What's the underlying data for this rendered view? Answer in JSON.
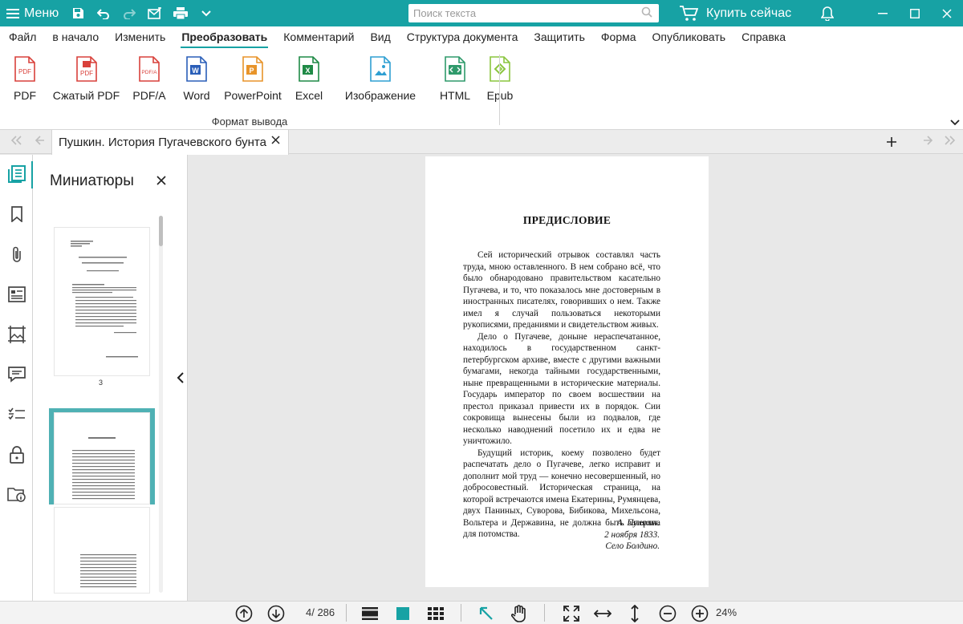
{
  "titlebar": {
    "menu_label": "Меню",
    "search_placeholder": "Поиск текста",
    "buy_label": "Купить сейчас"
  },
  "menubar": {
    "items": [
      "Файл",
      "в начало",
      "Изменить",
      "Преобразовать",
      "Комментарий",
      "Вид",
      "Структура документа",
      "Защитить",
      "Форма",
      "Опубликовать",
      "Справка"
    ],
    "active": "Преобразовать"
  },
  "ribbon": {
    "buttons": [
      {
        "label": "PDF",
        "icon": "pdf-icon",
        "color": "#d9413b"
      },
      {
        "label": "Сжатый PDF",
        "icon": "compressed-pdf-icon",
        "color": "#d9413b"
      },
      {
        "label": "PDF/A",
        "icon": "pdfa-icon",
        "color": "#d9413b"
      },
      {
        "label": "Word",
        "icon": "word-icon",
        "color": "#2a5eb8"
      },
      {
        "label": "PowerPoint",
        "icon": "powerpoint-icon",
        "color": "#e8942a"
      },
      {
        "label": "Excel",
        "icon": "excel-icon",
        "color": "#1f8a46"
      },
      {
        "label": "Изображение",
        "icon": "image-icon",
        "color": "#2e9fd2"
      },
      {
        "label": "HTML",
        "icon": "html-icon",
        "color": "#2f9a6b"
      },
      {
        "label": "Epub",
        "icon": "epub-icon",
        "color": "#8ac53e"
      }
    ],
    "group_caption": "Формат вывода"
  },
  "tabs": {
    "doc_title": "Пушкин. История Пугачевского бунта"
  },
  "thumbnails": {
    "title": "Миниатюры",
    "page_number": "3"
  },
  "document": {
    "heading": "ПРЕДИСЛОВИЕ",
    "paragraphs": [
      "Сей исторический отрывок составлял часть труда, мною оставленного. В нем собрано всё, что было обнародовано правительством касательно Пугачева, и то, что показалось мне достоверным в иностранных писателях, говоривших о нем. Также имел я случай пользоваться некоторыми рукописями, преданиями и свидетельством живых.",
      "Дело о Пугачеве, доныне нераспечатанное, находилось в государственном санкт-петербургском архиве, вместе с другими важными бумагами, некогда тайными государственными, ныне превращенными в исторические материалы. Государь император по своем восшествии на престол приказал привести их в порядок. Сии сокровища вынесены были из подвалов, где несколько наводнений посетило их и едва не уничтожило.",
      "Будущий историк, коему позволено будет распечатать дело о Пугачеве, легко исправит и дополнит мой труд — конечно несовершенный, но добросовестный. Историческая страница, на которой встречаются имена Екатерины, Румянцева, двух Паниных, Суворова, Бибикова, Михельсона, Вольтера и Державина, не должна быть затеряна для потомства."
    ],
    "signature": [
      "А. Пушкин.",
      "2 ноября 1833.",
      "Село Болдино."
    ]
  },
  "statusbar": {
    "page_indicator": "4/ 286",
    "zoom": "24%"
  },
  "colors": {
    "accent": "#17a2a4"
  }
}
